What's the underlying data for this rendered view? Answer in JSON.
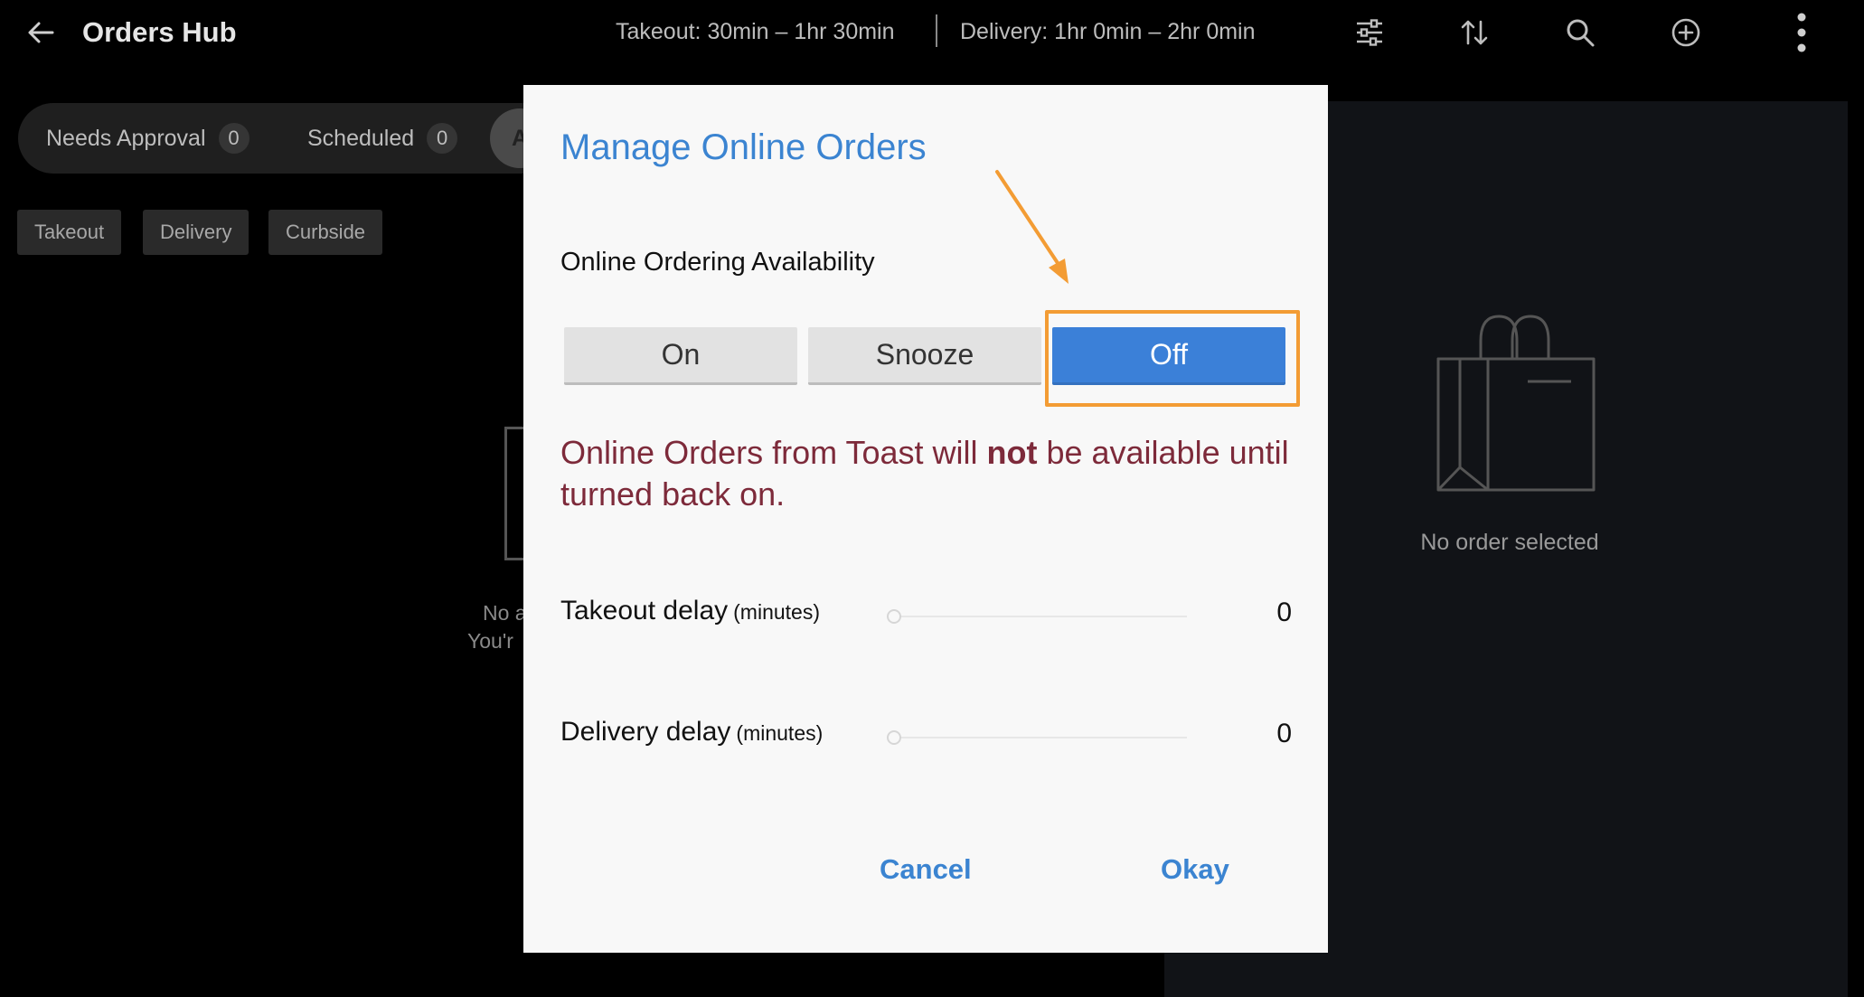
{
  "app": {
    "title": "Orders Hub",
    "takeout_time": "Takeout: 30min – 1hr 30min",
    "delivery_time": "Delivery: 1hr 0min – 2hr 0min"
  },
  "toolbar": {
    "back_icon": "arrow-left-icon",
    "icons": [
      "filter-sliders-icon",
      "sort-icon",
      "search-icon",
      "add-circle-icon",
      "more-vertical-icon"
    ]
  },
  "status_tabs": [
    {
      "label": "Needs Approval",
      "count": "0"
    },
    {
      "label": "Scheduled",
      "count": "0"
    }
  ],
  "active_tab_partial": "A",
  "filters": [
    "Takeout",
    "Delivery",
    "Curbside"
  ],
  "left_empty_state": {
    "line1": "No a",
    "line2": "You'r"
  },
  "detail_panel": {
    "empty_text": "No order selected",
    "icon": "shopping-bag-icon"
  },
  "dialog": {
    "title": "Manage Online Orders",
    "availability_label": "Online Ordering Availability",
    "options": [
      "On",
      "Snooze",
      "Off"
    ],
    "selected_option": "Off",
    "warning_before": "Online Orders from Toast will ",
    "warning_bold": "not",
    "warning_after": " be available until turned back on.",
    "takeout_delay": {
      "label": "Takeout delay",
      "unit": "(minutes)",
      "value": "0"
    },
    "delivery_delay": {
      "label": "Delivery delay",
      "unit": "(minutes)",
      "value": "0"
    },
    "cancel_label": "Cancel",
    "okay_label": "Okay"
  },
  "colors": {
    "accent_blue": "#3b84d1",
    "selected_button": "#3b80d8",
    "warning_text": "#7d2a3a",
    "annotation_orange": "#f39c34"
  }
}
